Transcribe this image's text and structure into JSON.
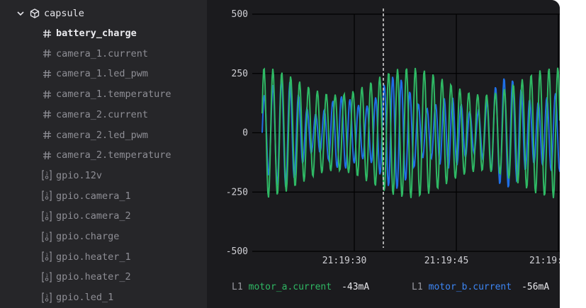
{
  "tree": {
    "root": {
      "label": "capsule",
      "icon": "cube-icon"
    },
    "items": [
      {
        "label": "battery_charge",
        "icon": "hash-icon",
        "selected": true
      },
      {
        "label": "camera_1.current",
        "icon": "hash-icon"
      },
      {
        "label": "camera_1.led_pwm",
        "icon": "hash-icon"
      },
      {
        "label": "camera_1.temperature",
        "icon": "hash-icon"
      },
      {
        "label": "camera_2.current",
        "icon": "hash-icon"
      },
      {
        "label": "camera_2.led_pwm",
        "icon": "hash-icon"
      },
      {
        "label": "camera_2.temperature",
        "icon": "hash-icon"
      },
      {
        "label": "gpio.12v",
        "icon": "boolean-icon"
      },
      {
        "label": "gpio.camera_1",
        "icon": "boolean-icon"
      },
      {
        "label": "gpio.camera_2",
        "icon": "boolean-icon"
      },
      {
        "label": "gpio.charge",
        "icon": "boolean-icon"
      },
      {
        "label": "gpio.heater_1",
        "icon": "boolean-icon"
      },
      {
        "label": "gpio.heater_2",
        "icon": "boolean-icon"
      },
      {
        "label": "gpio.led_1",
        "icon": "boolean-icon"
      }
    ]
  },
  "colors": {
    "green": "#2fb864",
    "blue": "#1f6fe6"
  },
  "chart_data": {
    "type": "line",
    "ylim": [
      -500,
      500
    ],
    "yticks": [
      "500",
      "250",
      "0",
      "-250",
      "-500"
    ],
    "xticks": [
      "21:19:30",
      "21:19:45",
      "21:19:"
    ],
    "series": [
      {
        "name": "motor_a.current",
        "color": "#2fb864"
      },
      {
        "name": "motor_b.current",
        "color": "#1f6fe6"
      }
    ]
  },
  "legend": [
    {
      "id": "L1",
      "name": "motor_a.current",
      "value": "-43mA",
      "color": "#2fb864"
    },
    {
      "id": "L1",
      "name": "motor_b.current",
      "value": "-56mA",
      "color": "#1f6fe6"
    }
  ]
}
